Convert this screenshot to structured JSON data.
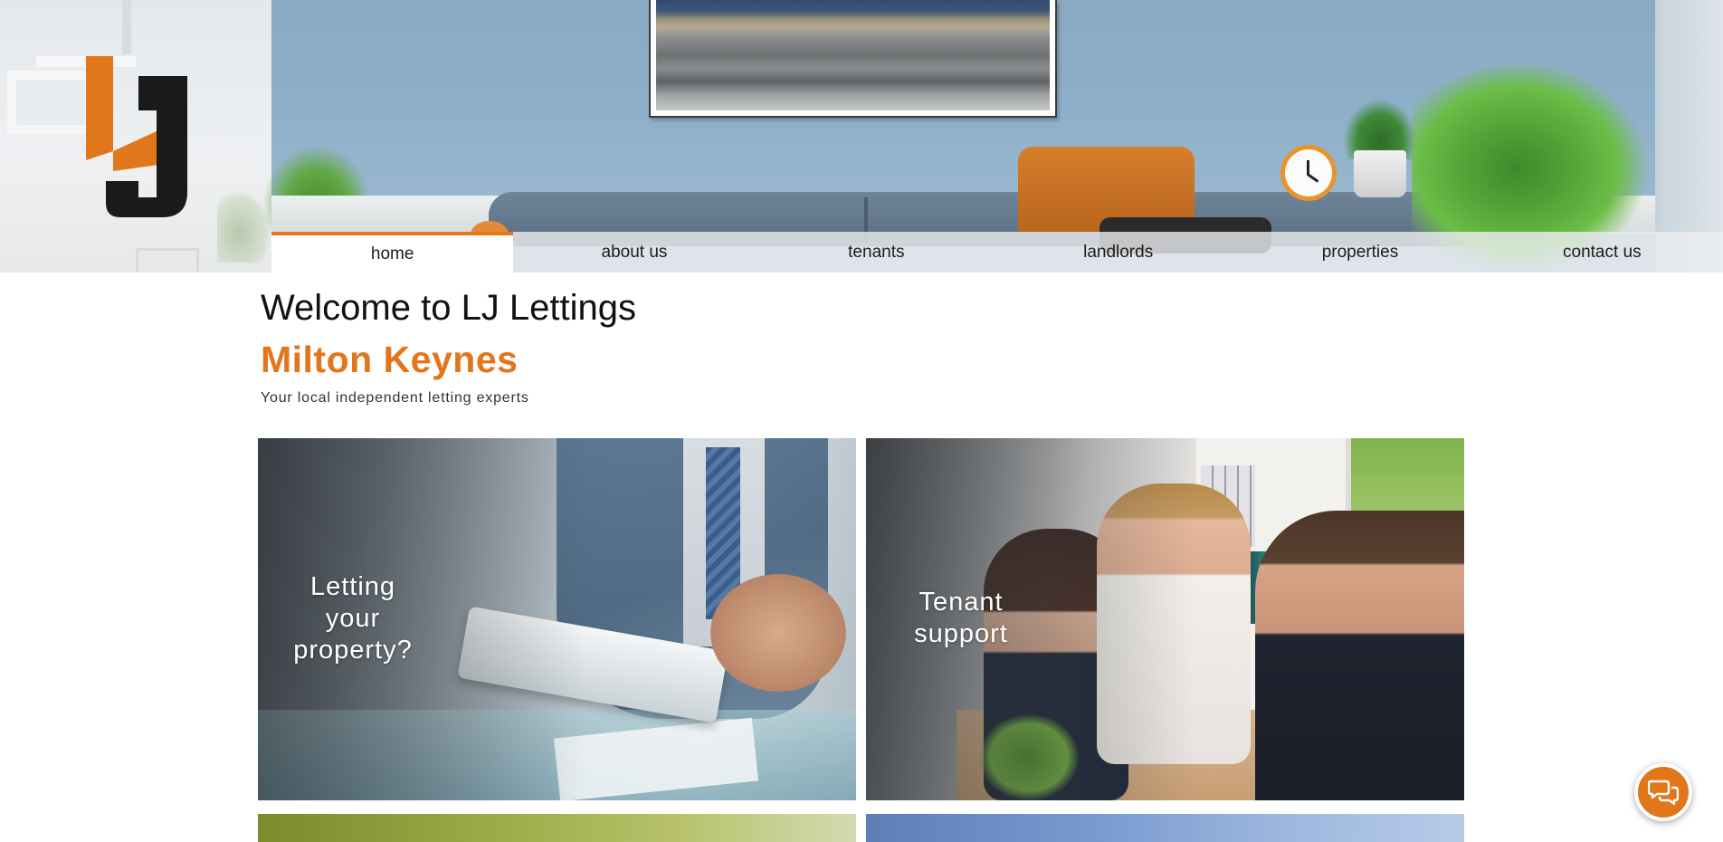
{
  "nav": {
    "items": [
      {
        "label": "home",
        "active": true
      },
      {
        "label": "about us",
        "active": false
      },
      {
        "label": "tenants",
        "active": false
      },
      {
        "label": "landlords",
        "active": false
      },
      {
        "label": "properties",
        "active": false
      },
      {
        "label": "contact us",
        "active": false
      }
    ]
  },
  "main": {
    "title": "Welcome to LJ Lettings",
    "location": "Milton Keynes",
    "tagline": "Your local independent letting experts"
  },
  "tiles": [
    {
      "label": "Letting your property?"
    },
    {
      "label": "Tenant support"
    }
  ],
  "colors": {
    "accent": "#e2761b",
    "logo_dark": "#1a1a1a"
  },
  "icons": {
    "logo": "lj-logo-icon",
    "chat": "chat-bubbles-icon"
  }
}
